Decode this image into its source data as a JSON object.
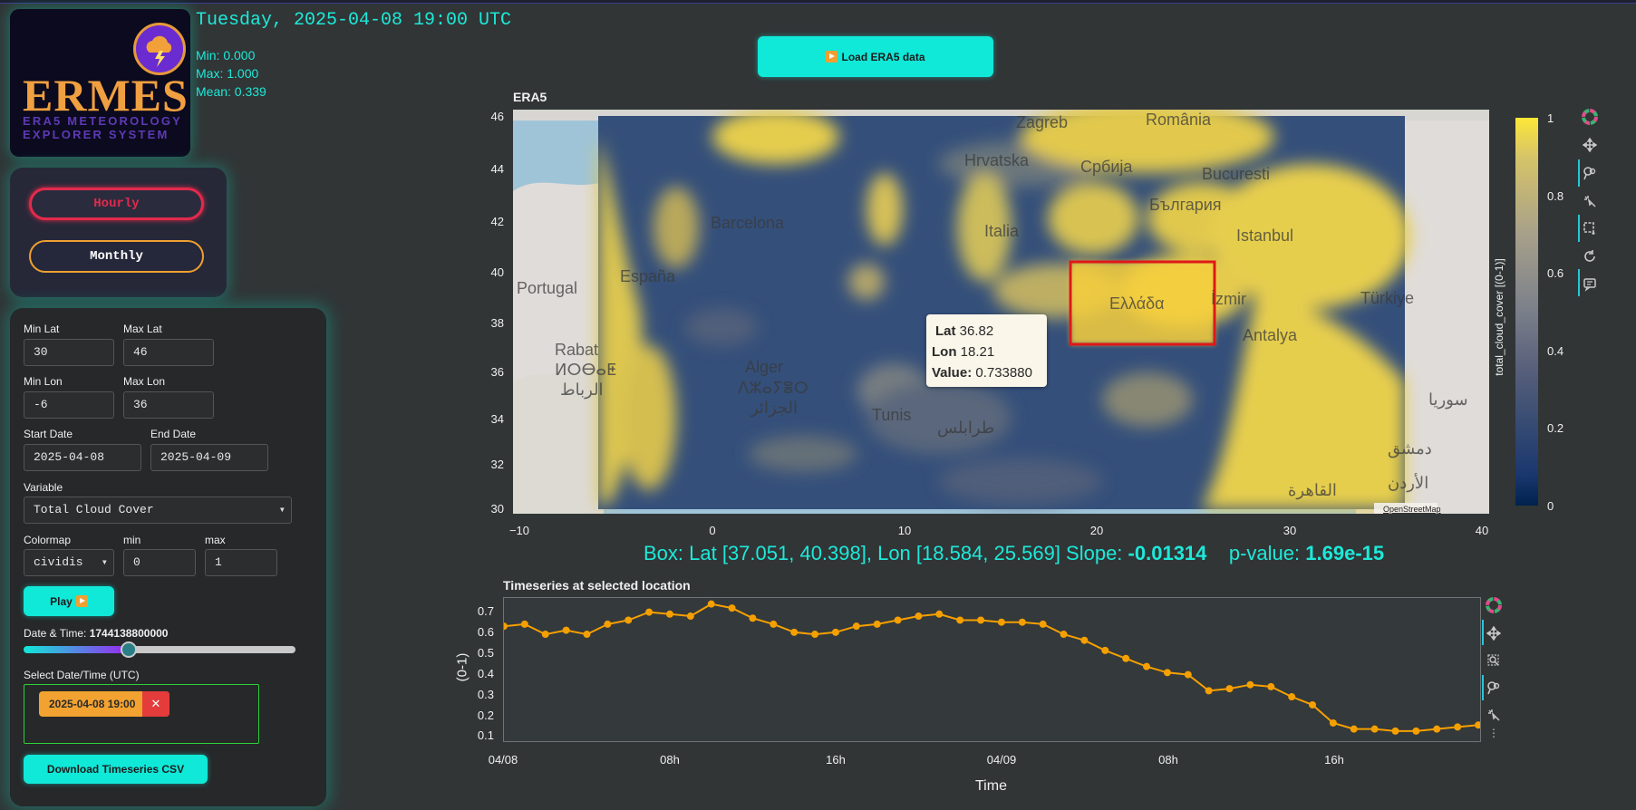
{
  "logo": {
    "word": "ERMES",
    "subtitle_line1": "ERA5 METEOROLOGY",
    "subtitle_line2": "EXPLORER SYSTEM"
  },
  "header": {
    "datetime": "Tuesday, 2025-04-08 19:00 UTC",
    "min": "Min: 0.000",
    "max": "Max: 1.000",
    "mean": "Mean: 0.339"
  },
  "mode": {
    "hourly": "Hourly",
    "monthly": "Monthly"
  },
  "controls": {
    "min_lat_label": "Min Lat",
    "min_lat": "30",
    "max_lat_label": "Max Lat",
    "max_lat": "46",
    "min_lon_label": "Min Lon",
    "min_lon": "-6",
    "max_lon_label": "Max Lon",
    "max_lon": "36",
    "start_date_label": "Start Date",
    "start_date": "2025-04-08",
    "end_date_label": "End Date",
    "end_date": "2025-04-09",
    "variable_label": "Variable",
    "variable": "Total Cloud Cover",
    "colormap_label": "Colormap",
    "colormap": "cividis",
    "min_label": "min",
    "min": "0",
    "max_label": "max",
    "max": "1",
    "play_label": "Play",
    "datetime_label": "Date & Time:",
    "datetime_value": "1744138800000",
    "slider_fraction": 0.39,
    "select_label": "Select Date/Time (UTC)",
    "selected_chip": "2025-04-08 19:00",
    "chip_close": "✕",
    "download_label": "Download Timeseries CSV"
  },
  "main": {
    "load_button": "Load ERA5 data",
    "map_title": "ERA5",
    "map_yticks": [
      "46",
      "44",
      "42",
      "40",
      "38",
      "36",
      "34",
      "32",
      "30"
    ],
    "map_xticks": [
      "−10",
      "0",
      "10",
      "20",
      "30",
      "40"
    ],
    "colorbar_ticks": [
      "1",
      "0.8",
      "0.6",
      "0.4",
      "0.2",
      "0"
    ],
    "colorbar_label": "total_cloud_cover [(0-1)]",
    "attribution": "OpenStreetMap",
    "place_labels": [
      "Portugal",
      "España",
      "Barcelona",
      "Rabat",
      "ⵍⵔⴱⴰⵟ",
      "الرباط",
      "Alger",
      "ⴷⵣⴰⵢⴻⵔ",
      "الجزائر",
      "Tunis",
      "طرابلس",
      "Hrvatska",
      "Zagreb",
      "Србија",
      "România",
      "Bucuresti",
      "България",
      "Istanbul",
      "Ελλάδα",
      "İzmir",
      "Türkiye",
      "Antalya",
      "سوريا",
      "دمشق",
      "الأردن",
      "القاهرة",
      "Italia"
    ],
    "tooltip": {
      "lat_label": "Lat",
      "lat": "36.82",
      "lon_label": "Lon",
      "lon": "18.21",
      "value_label": "Value:",
      "value": "0.733880"
    },
    "box_text": "Box: Lat [37.051, 40.398], Lon [18.584, 25.569] Slope:",
    "slope": "-0.01314",
    "pvalue_label": "p-value:",
    "pvalue": "1.69e-15"
  },
  "timeseries": {
    "title": "Timeseries at selected location",
    "ylabel": "(0-1)",
    "xlabel": "Time",
    "yticks": [
      "0.7",
      "0.6",
      "0.5",
      "0.4",
      "0.3",
      "0.2",
      "0.1"
    ],
    "xticks": [
      "04/08",
      "08h",
      "16h",
      "04/09",
      "08h",
      "16h"
    ]
  },
  "chart_data": {
    "type": "line",
    "title": "Timeseries at selected location",
    "xlabel": "Time",
    "ylabel": "(0-1)",
    "x": [
      "04/08 00h",
      "01h",
      "02h",
      "03h",
      "04h",
      "05h",
      "06h",
      "07h",
      "08h",
      "09h",
      "10h",
      "11h",
      "12h",
      "13h",
      "14h",
      "15h",
      "16h",
      "17h",
      "18h",
      "19h",
      "20h",
      "21h",
      "22h",
      "23h",
      "04/09 00h",
      "01h",
      "02h",
      "03h",
      "04h",
      "05h",
      "06h",
      "07h",
      "08h",
      "09h",
      "10h",
      "11h",
      "12h",
      "13h",
      "14h",
      "15h",
      "16h",
      "17h",
      "18h",
      "19h",
      "20h",
      "21h",
      "22h",
      "23h"
    ],
    "values": [
      0.62,
      0.63,
      0.58,
      0.6,
      0.58,
      0.63,
      0.65,
      0.69,
      0.68,
      0.67,
      0.73,
      0.71,
      0.66,
      0.63,
      0.59,
      0.58,
      0.59,
      0.62,
      0.63,
      0.65,
      0.67,
      0.68,
      0.65,
      0.65,
      0.64,
      0.64,
      0.63,
      0.58,
      0.55,
      0.5,
      0.46,
      0.42,
      0.39,
      0.38,
      0.3,
      0.31,
      0.33,
      0.32,
      0.27,
      0.23,
      0.14,
      0.11,
      0.11,
      0.1,
      0.1,
      0.11,
      0.12,
      0.13
    ],
    "ylim": [
      0.05,
      0.76
    ],
    "color": "#f5a000"
  },
  "colors": {
    "accent": "#1de9d9",
    "cyan_button": "#10e8d8",
    "hourly_border": "#e22a4c",
    "monthly_border": "#f0a030",
    "selection_box": "#e01818"
  }
}
